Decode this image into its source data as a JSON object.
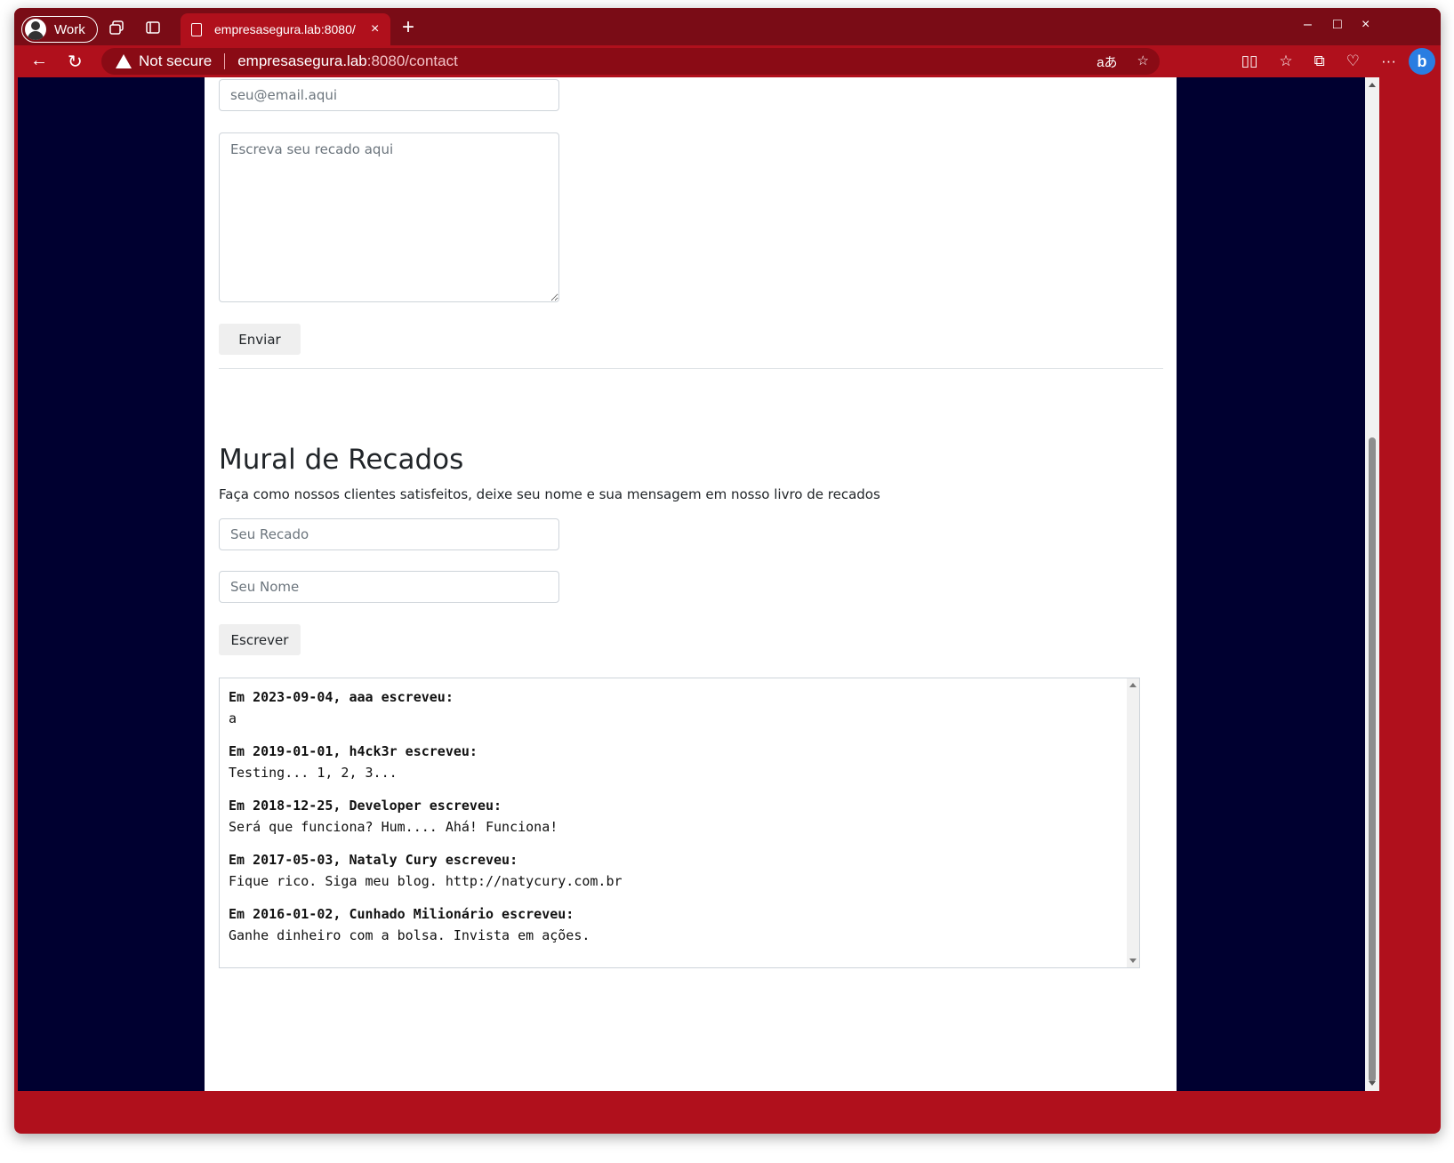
{
  "browser": {
    "profile_label": "Work",
    "tab_title": "empresasegura.lab:8080/",
    "tab_close": "×",
    "new_tab": "+",
    "security_label": "Not secure",
    "url_host": "empresasegura.lab",
    "url_rest": ":8080/contact",
    "window_controls": {
      "minimize": "–",
      "maximize": "□",
      "close": "×"
    },
    "nav": {
      "back": "←",
      "reload": "↻"
    },
    "omnibox_icons": {
      "read_aloud": "aあ",
      "favorite": "☆"
    },
    "toolbar_icons": {
      "split": "▯▯",
      "favorites": "☆",
      "collections": "⧉",
      "performance": "♡",
      "more": "···",
      "bing": "b"
    },
    "accent_color": "#b0101c"
  },
  "contact_form": {
    "email_placeholder": "seu@email.aqui",
    "message_placeholder": "Escreva seu recado aqui",
    "submit_label": "Enviar"
  },
  "mural": {
    "title": "Mural de Recados",
    "subtitle": "Faça como nossos clientes satisfeitos, deixe seu nome e sua mensagem em nosso livro de recados",
    "recado_placeholder": "Seu Recado",
    "nome_placeholder": "Seu Nome",
    "submit_label": "Escrever",
    "entries": [
      {
        "header": "Em 2023-09-04, aaa escreveu:",
        "message": "a"
      },
      {
        "header": "Em 2019-01-01, h4ck3r escreveu:",
        "message": "Testing... 1, 2, 3..."
      },
      {
        "header": "Em 2018-12-25, Developer escreveu:",
        "message": "Será que funciona? Hum.... Ahá! Funciona!"
      },
      {
        "header": "Em 2017-05-03, Nataly Cury escreveu:",
        "message": "Fique rico. Siga meu blog. http://natycury.com.br"
      },
      {
        "header": "Em 2016-01-02, Cunhado Milionário escreveu:",
        "message": "Ganhe dinheiro com a bolsa. Invista em ações."
      }
    ]
  }
}
